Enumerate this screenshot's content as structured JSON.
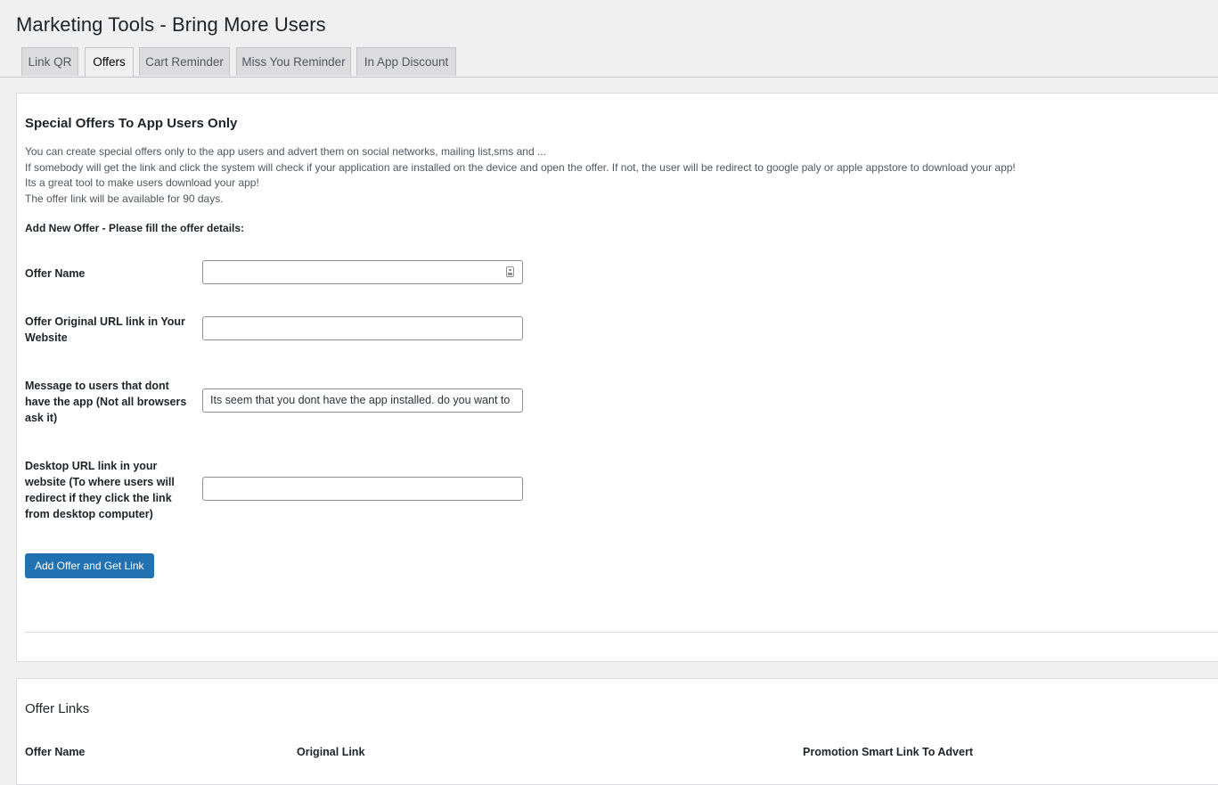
{
  "page": {
    "title": "Marketing Tools - Bring More Users"
  },
  "tabs": [
    {
      "label": "Link QR",
      "active": false
    },
    {
      "label": "Offers",
      "active": true
    },
    {
      "label": "Cart Reminder",
      "active": false
    },
    {
      "label": "Miss You Reminder",
      "active": false
    },
    {
      "label": "In App Discount",
      "active": false
    }
  ],
  "offers": {
    "title": "Special Offers To App Users Only",
    "description": [
      "You can create special offers only to the app users and advert them on social networks, mailing list,sms and ...",
      "If somebody will get the link and click the system will check if your application are installed on the device and open the offer. If not, the user will be redirect to google paly or apple appstore to download your app!",
      "Its a great tool to make users download your app!",
      "The offer link will be available for 90 days."
    ],
    "subheading": "Add New Offer - Please fill the offer details:",
    "fields": {
      "offer_name": {
        "label": "Offer Name",
        "value": ""
      },
      "original_url": {
        "label": "Offer Original URL link in Your Website",
        "value": ""
      },
      "message": {
        "label": "Message to users that dont have the app (Not all browsers ask it)",
        "value": "Its seem that you dont have the app installed. do you want to"
      },
      "desktop_url": {
        "label": "Desktop URL link in your website (To where users will redirect if they click the link from desktop computer)",
        "value": ""
      }
    },
    "submit_label": "Add Offer and Get Link"
  },
  "offer_links": {
    "title": "Offer Links",
    "columns": [
      "Offer Name",
      "Original Link",
      "Promotion Smart Link To Advert"
    ]
  },
  "colors": {
    "primary": "#2271b1",
    "background": "#f0f0f1",
    "panel": "#ffffff",
    "text": "#1d2327"
  }
}
